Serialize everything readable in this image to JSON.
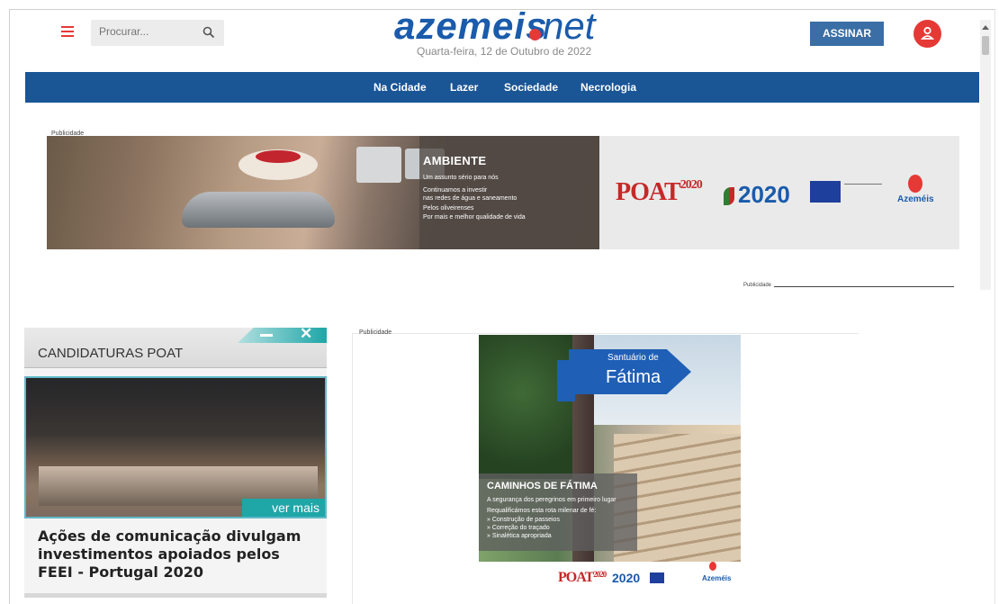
{
  "header": {
    "search_placeholder": "Procurar...",
    "logo_text": "azemeis",
    "logo_suffix": "net",
    "date": "Quarta-feira, 12 de Outubro de 2022",
    "subscribe_label": "ASSINAR"
  },
  "nav": {
    "items": [
      {
        "label": "Na Cidade"
      },
      {
        "label": "Lazer"
      },
      {
        "label": "Sociedade"
      },
      {
        "label": "Necrologia"
      }
    ]
  },
  "ads": {
    "label": "Publicidade",
    "banner": {
      "title": "AMBIENTE",
      "lines": [
        "Um assunto sério para nós",
        "Continuamos a investir",
        "nas redes de água e saneamento",
        "Pelos oliveirenses",
        "Por mais e melhor qualidade de vida"
      ],
      "logos": {
        "poat": "POAT",
        "poat_year": "2020",
        "portugal2020": "2020",
        "azemeis": "Azeméis"
      }
    },
    "fatima": {
      "sign_small": "Santuário de",
      "sign_big": "Fátima",
      "title": "CAMINHOS DE FÁTIMA",
      "lines": [
        "A segurança dos peregrinos em primeiro lugar",
        "Requalificámos esta rota milenar de fé:",
        "» Construção de passeios",
        "» Correção do traçado",
        "» Sinalética apropriada"
      ],
      "logos": {
        "poat": "POAT",
        "poat_year": "2020",
        "portugal2020": "2020",
        "azemeis": "Azeméis"
      }
    }
  },
  "poat_panel": {
    "title": "CANDIDATURAS POAT",
    "more_label": "ver mais",
    "headline": "Ações de comunicação divulgam investimentos apoiados pelos FEEI - Portugal 2020"
  },
  "colors": {
    "brand_blue": "#1a5596",
    "accent_red": "#e53935",
    "teal": "#1fa6a7"
  }
}
